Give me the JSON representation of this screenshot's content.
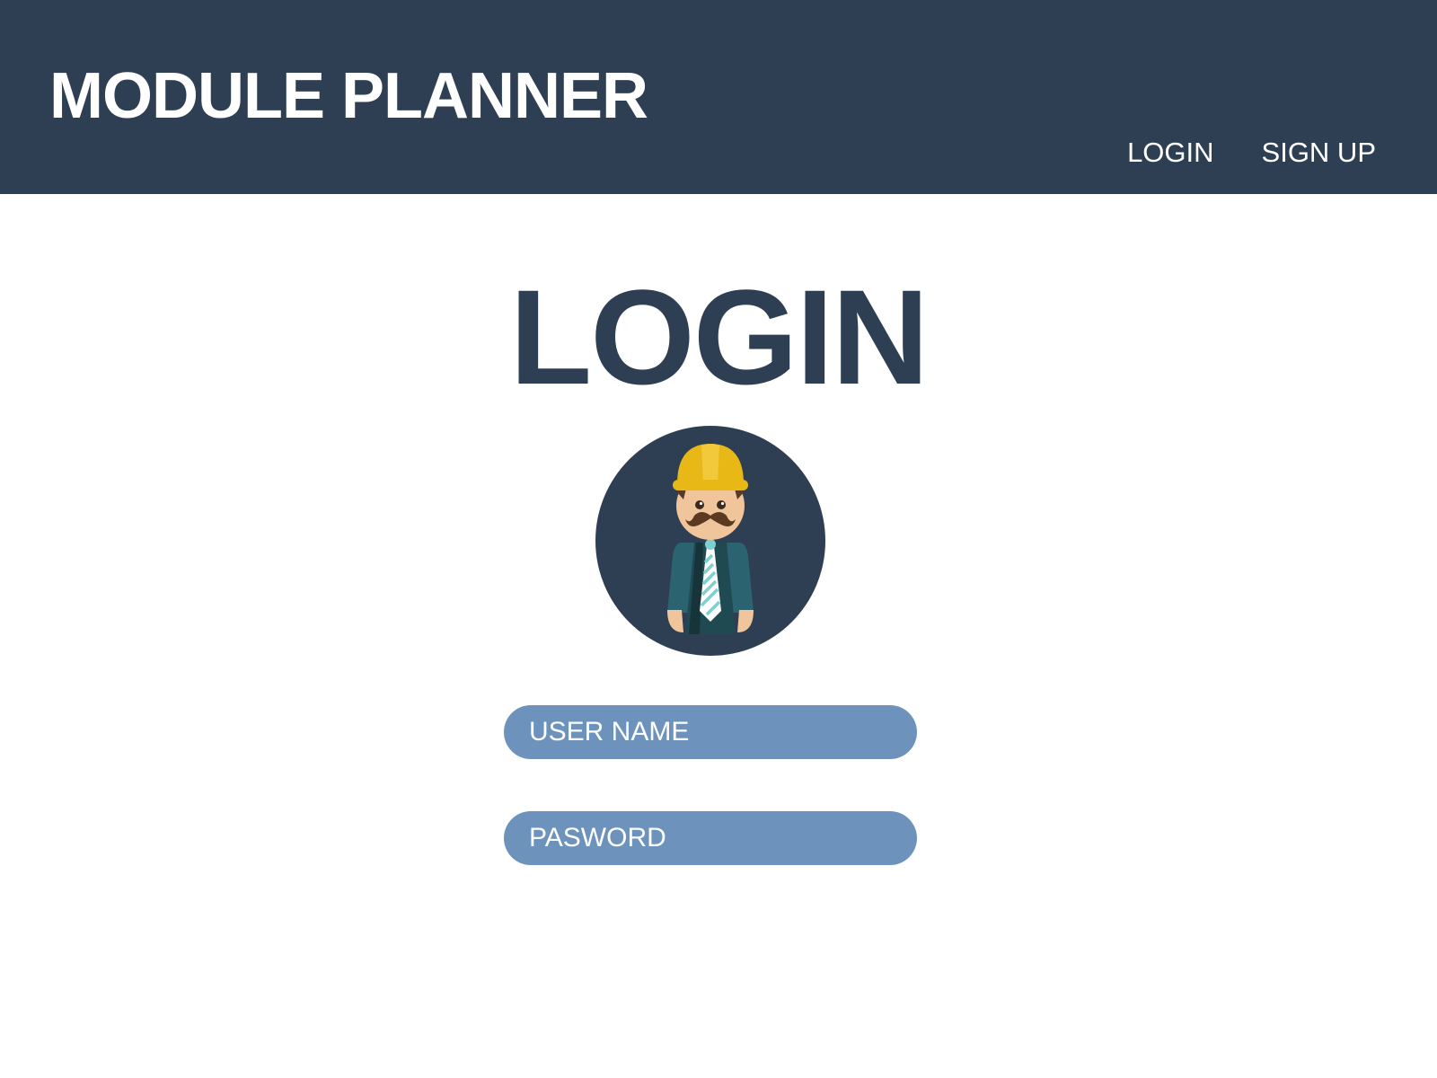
{
  "header": {
    "title": "MODULE PLANNER",
    "nav": {
      "login": "LOGIN",
      "signup": "SIGN UP"
    }
  },
  "main": {
    "heading": "LOGIN",
    "avatar_icon": "builder-avatar-icon",
    "username": {
      "placeholder": "USER NAME",
      "value": ""
    },
    "password": {
      "placeholder": "PASWORD",
      "value": ""
    }
  },
  "colors": {
    "header_bg": "#2f3f53",
    "heading": "#2f3f53",
    "field_bg": "#6d93bc",
    "helmet": "#e8b817",
    "suit": "#2b6470"
  }
}
